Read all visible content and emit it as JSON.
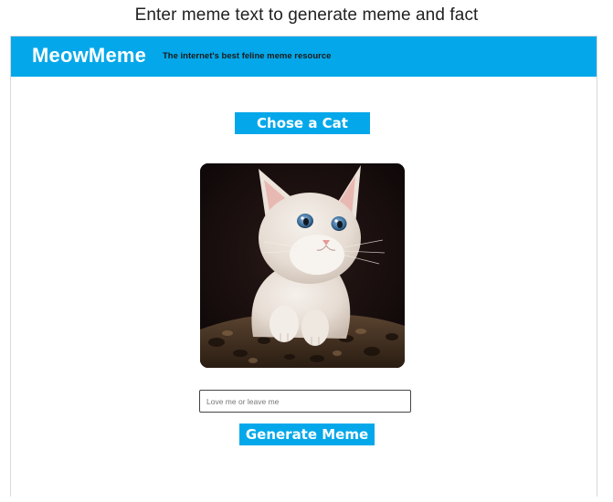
{
  "page": {
    "caption": "Enter meme text to generate meme and fact"
  },
  "header": {
    "brand": "MeowMeme",
    "tagline": "The internet's best feline meme resource",
    "background_color": "#04a8ea"
  },
  "main": {
    "choose_button_label": "Chose a Cat",
    "cat_image": {
      "description_icon": "kitten-photo"
    },
    "meme_input": {
      "value": "",
      "placeholder": "Love me or leave me"
    },
    "generate_button_label": "Generate Meme"
  },
  "colors": {
    "accent": "#04a8ea",
    "button_text": "#ffffff"
  }
}
